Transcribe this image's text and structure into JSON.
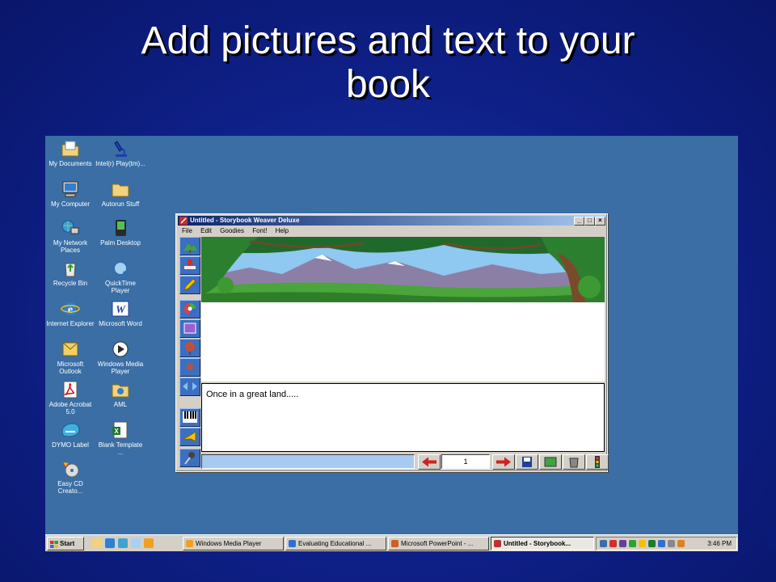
{
  "slide": {
    "title_lines": [
      "Add pictures and text to your",
      "book"
    ]
  },
  "desktop": {
    "icons": [
      {
        "label": "My Documents",
        "icon": "folder-documents-icon"
      },
      {
        "label": "Intel(r) Play(tm)...",
        "icon": "microscope-icon"
      },
      {
        "label": "My Computer",
        "icon": "computer-icon"
      },
      {
        "label": "Autorun Stuff",
        "icon": "folder-icon"
      },
      {
        "label": "My Network Places",
        "icon": "network-icon"
      },
      {
        "label": "Palm Desktop",
        "icon": "palm-icon"
      },
      {
        "label": "Recycle Bin",
        "icon": "recycle-bin-icon"
      },
      {
        "label": "QuickTime Player",
        "icon": "quicktime-icon"
      },
      {
        "label": "Internet Explorer",
        "icon": "internet-explorer-icon"
      },
      {
        "label": "Microsoft Word",
        "icon": "word-icon"
      },
      {
        "label": "Microsoft Outlook",
        "icon": "outlook-icon"
      },
      {
        "label": "Windows Media Player",
        "icon": "media-player-icon"
      },
      {
        "label": "Adobe Acrobat 5.0",
        "icon": "acrobat-icon"
      },
      {
        "label": "AML",
        "icon": "folder-globe-icon"
      },
      {
        "label": "DYMO Label",
        "icon": "dymo-icon"
      },
      {
        "label": "Blank Template ...",
        "icon": "excel-icon"
      },
      {
        "label": "Easy CD Creato...",
        "icon": "cd-creator-icon"
      }
    ]
  },
  "app_window": {
    "title": "Untitled - Storybook Weaver Deluxe",
    "window_buttons": [
      "_",
      "□",
      "×"
    ],
    "menu": [
      "File",
      "Edit",
      "Goodies",
      "Font!",
      "Help"
    ],
    "story_text": "Once in a great land.....",
    "page_number": "1"
  },
  "taskbar": {
    "start_label": "Start",
    "tasks": [
      {
        "label": "Windows Media Player",
        "active": false
      },
      {
        "label": "Evaluating Educational ...",
        "active": false
      },
      {
        "label": "Microsoft PowerPoint - ...",
        "active": false
      },
      {
        "label": "Untitled - Storybook...",
        "active": true
      }
    ],
    "clock": "3:46 PM"
  },
  "colors": {
    "desktop": "#3a6ea5",
    "titlebar_start": "#0a246a",
    "titlebar_end": "#a6caf0",
    "tool_button": "#3c6fbf"
  }
}
